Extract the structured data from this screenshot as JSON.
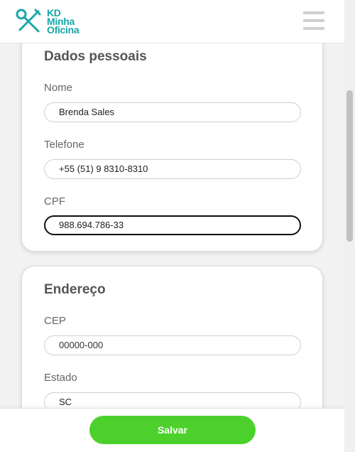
{
  "header": {
    "logo_lines": [
      "KD",
      "Minha",
      "Oficina"
    ],
    "brand_color": "#19a7a8"
  },
  "personal": {
    "title": "Dados pessoais",
    "name_label": "Nome",
    "name_value": "Brenda Sales",
    "phone_label": "Telefone",
    "phone_value": "+55 (51) 9 8310-8310",
    "cpf_label": "CPF",
    "cpf_value": "988.694.786-33"
  },
  "address": {
    "title": "Endereço",
    "cep_label": "CEP",
    "cep_placeholder": "00000-000",
    "state_label": "Estado",
    "state_value": "SC"
  },
  "footer": {
    "save_label": "Salvar",
    "save_color": "#4cd12c"
  }
}
